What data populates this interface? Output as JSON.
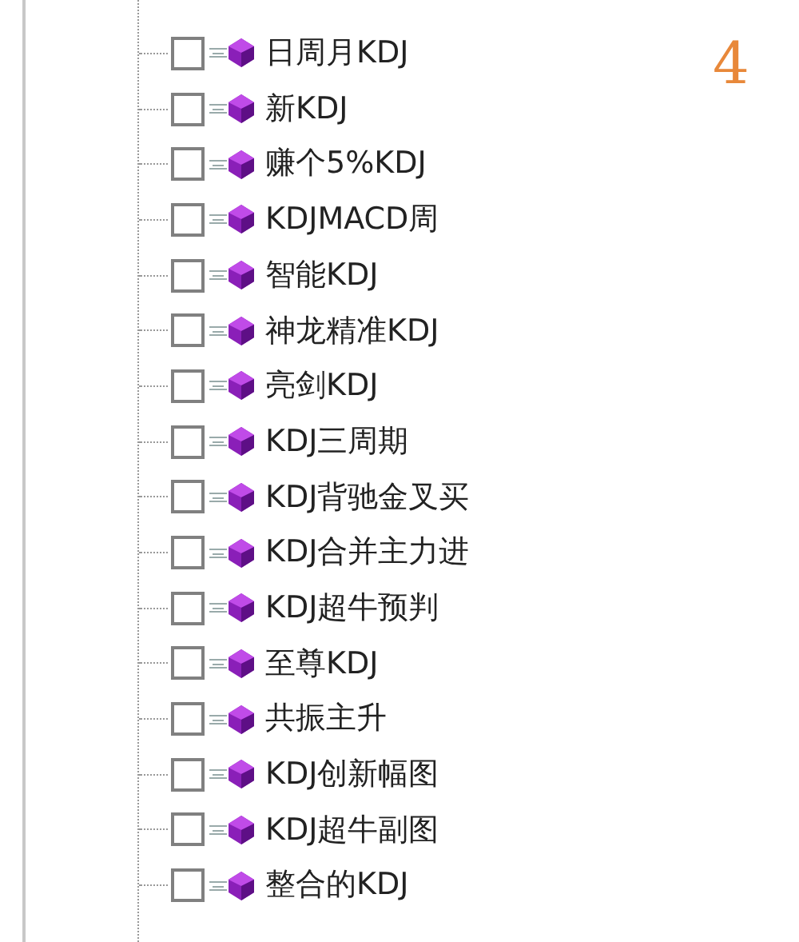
{
  "page_number": "4",
  "tree": {
    "items": [
      {
        "label": "日周月KDJ",
        "checked": false
      },
      {
        "label": "新KDJ",
        "checked": false
      },
      {
        "label": "赚个5%KDJ",
        "checked": false
      },
      {
        "label": "KDJMACD周",
        "checked": false
      },
      {
        "label": "智能KDJ",
        "checked": false
      },
      {
        "label": "神龙精准KDJ",
        "checked": false
      },
      {
        "label": "亮剑KDJ",
        "checked": false
      },
      {
        "label": "KDJ三周期",
        "checked": false
      },
      {
        "label": "KDJ背驰金叉买",
        "checked": false
      },
      {
        "label": "KDJ合并主力进",
        "checked": false
      },
      {
        "label": "KDJ超牛预判",
        "checked": false
      },
      {
        "label": "至尊KDJ",
        "checked": false
      },
      {
        "label": "共振主升",
        "checked": false
      },
      {
        "label": "KDJ创新幅图",
        "checked": false
      },
      {
        "label": "KDJ超牛副图",
        "checked": false
      },
      {
        "label": "整合的KDJ",
        "checked": false
      }
    ]
  }
}
